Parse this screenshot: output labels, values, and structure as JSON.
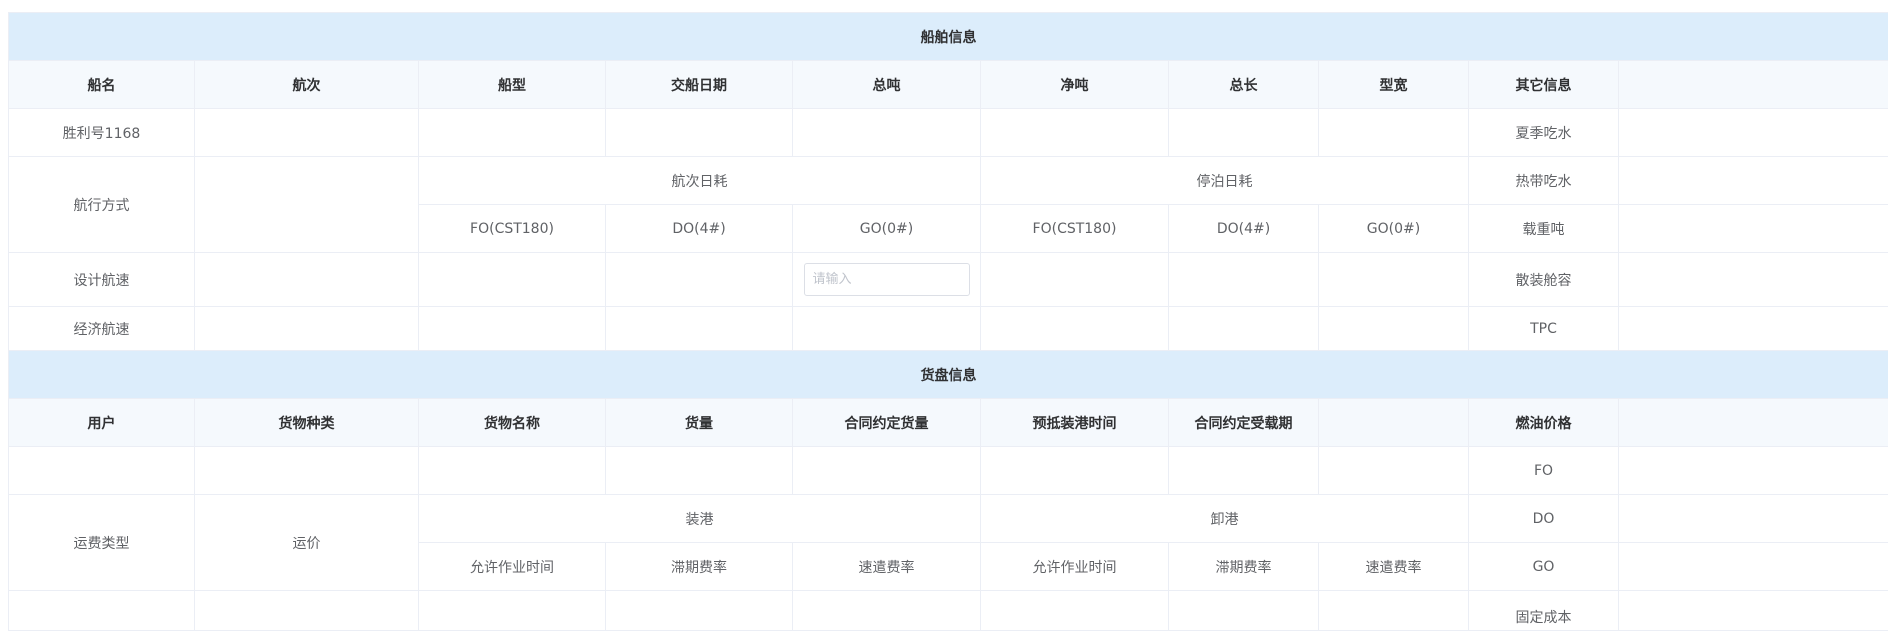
{
  "ship_section": {
    "title": "船舶信息",
    "headers": [
      "船名",
      "航次",
      "船型",
      "交船日期",
      "总吨",
      "净吨",
      "总长",
      "型宽",
      "其它信息"
    ],
    "ship_name": "胜利号1168",
    "sailing_mode_label": "航次日耗",
    "sailing_mode": "航行方式",
    "voyage_daily_consumption": "航次日耗",
    "berthing_daily_consumption": "停泊日耗",
    "fuel_types": [
      "FO(CST180)",
      "DO(4#)",
      "GO(0#)",
      "FO(CST180)",
      "DO(4#)",
      "GO(0#)"
    ],
    "design_speed": "设计航速",
    "economic_speed": "经济航速",
    "input_placeholder": "请输入",
    "other_info": [
      "夏季吃水",
      "热带吃水",
      "载重吨",
      "散装舱容",
      "TPC"
    ]
  },
  "cargo_section": {
    "title": "货盘信息",
    "headers": [
      "用户",
      "货物种类",
      "货物名称",
      "货量",
      "合同约定货量",
      "预抵装港时间",
      "合同约定受载期",
      "",
      "燃油价格"
    ],
    "freight_type": "运费类型",
    "freight_rate": "运价",
    "loading_port": "装港",
    "discharge_port": "卸港",
    "port_terms": [
      "允许作业时间",
      "滞期费率",
      "速遣费率",
      "允许作业时间",
      "滞期费率",
      "速遣费率"
    ],
    "fuel_prices": [
      "FO",
      "DO",
      "GO",
      "固定成本"
    ]
  }
}
